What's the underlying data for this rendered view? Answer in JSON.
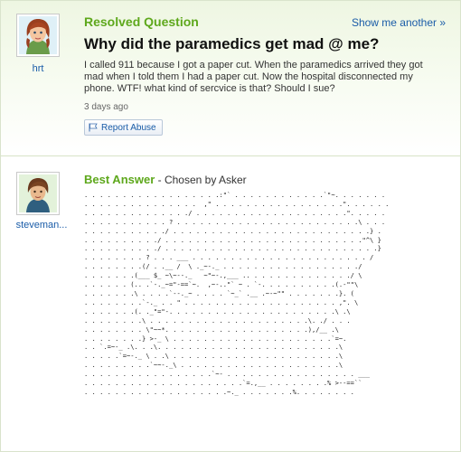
{
  "question": {
    "status": "Resolved Question",
    "show_another": "Show me another »",
    "title": "Why did the paramedics get mad @ me?",
    "body": "I called 911 because I got a paper cut. When the paramedics arrived they got mad when I told them I had a paper cut. Now the hospital disconnected my phone. WTF! what kind of sercvice is that? Should I sue?",
    "time": "3 days ago",
    "report_label": "Report Abuse",
    "asker": "hrt"
  },
  "answer": {
    "label": "Best Answer",
    "chosen": " - Chosen by Asker",
    "answerer": "steveman...",
    "ascii_art": ". . . . . . . . . . . . . . . . . .:\"` . . . . . . . . . . . .`\"~. . . . . . .\n. . . . . . . . . . . . . . .  ,\" . . . . . . . . . . . . . . . . .\". . . . . .\n. . . . . . . . . . . . . ./ . . . . . . . . . . . . . . . . . . . .\". . . . .\n. . . . . . . . . . . ? . . . . . . . . . . . . . . . . . . . . . . . .\\ . . .\n. . . . . . . . . . ./ . . . . . . . . . . . . . . . . . . . . . . . . . .} .\n. . . . . . . . . ./ . . . . . . . . . . . . . . . . . . . . . . . . . .\"^\\ }\n. . . . . . . . . ./ . . . . . . . . . . . . . . . . . . . . . . . . . . . .}\n. . . . . . . . ? . . . ___ . . . . . . . . . . . . . . . . . . . . . . . /\n. . . . . . . .(/ . .__ /  \\ ._~-._ . . . . . . . . . . . . . . . . . ./\n. . . . . . .(___ $_ ~\\~--._   ~\"~-.,___ .. . . . . . . . . . . . . ./ \\\n. . . . . . (.. .`-._~=\"-==`~.  ,~-..\"` ~ . `-. . . . . . . . . .(.-\"\"\\\n. . . . . . .\\ . . . .`--._~ . . . . `~_` .__ .~-~\"\" . . . . . . .}. (\n. . . . . . . .`-._ . . \" . . . . . . . . . . . . . . . . . . . . ,\". \\\n. . . . . . .(. ._\"=\"-. . . . . . . . . . . . . . . . . . . . . .\\ .\\\n. . . . . . . .\\ . . . . . . . . . . . . . . . . . . . . .\\. ./ . . .\n. . . . . . . . \\\"~~*. . . . . . . . . . . . . . . . . . .),/__ .\\\n. . . . . . . .} >-_ \\ . . . . . . . . . . . . . . . . . . . . .`=~.\n. . `.=~-_ .\\. . .\\. . . . . . . . . . . . . . . . . . . . . . . .\\\n. . . . .`=~-._ \\ . .\\ . . . . . . . . . . . . . . . . . . . . . .\\\n. . . . . . . . .`~~-._\\ . . . . . . . . . . . . . . . . . . . . .\\\n. . . . . . . . . . . . . . . . .`~- . . . . . . . . . . . . . . . . . ___\n. . . . . . . . . . . . . . . . . . . . .`=.,__ . . . . . . . .% >--==``\n. . . . . . . . . . . . . . . . . . .~._ . . . . . . .%. . . . . . . ."
  },
  "colors": {
    "accent_green": "#5ea81c",
    "link_blue": "#1a5ca8",
    "header_bg": "#eef6e2"
  },
  "icons": {
    "report": "flag-icon",
    "asker_avatar": "cartoon-avatar-redhead",
    "answerer_avatar": "cartoon-avatar-brown-hair"
  }
}
